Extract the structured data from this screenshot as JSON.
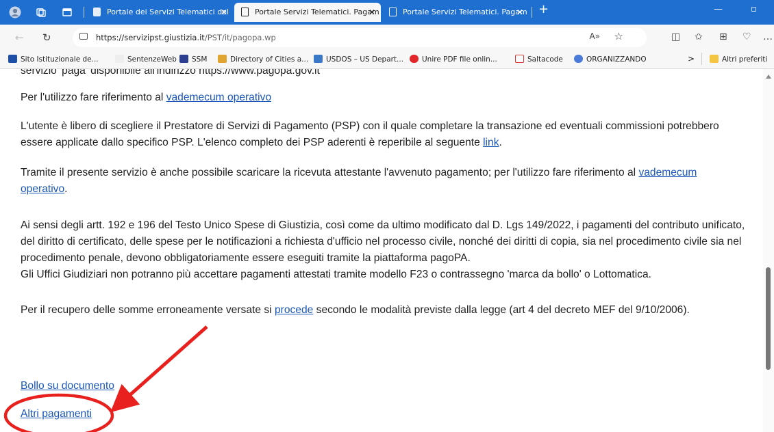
{
  "browser": {
    "tabs": [
      {
        "label": "Portale dei Servizi Telematici del"
      },
      {
        "label": "Portale Servizi Telematici. Pagam"
      },
      {
        "label": "Portale Servizi Telematici. Pagam"
      }
    ],
    "new_tab": "+",
    "address": {
      "host": "https://servizipst.giustizia.it",
      "path": "/PST/it/pagopa.wp"
    },
    "bookmarks": [
      {
        "label": "Sito Istituzionale de..."
      },
      {
        "label": "SentenzeWeb"
      },
      {
        "label": "SSM"
      },
      {
        "label": "Directory of Cities a..."
      },
      {
        "label": "USDOS – US Depart..."
      },
      {
        "label": "Unire PDF file onlin..."
      },
      {
        "label": "Saltacode"
      },
      {
        "label": "ORGANIZZANDO"
      }
    ],
    "bookmarks_more": ">",
    "other_favorites": "Altri preferiti"
  },
  "content": {
    "cut_line": "servizio 'paga' disponibile all'indirizzo https://www.pagopa.gov.it",
    "p1": {
      "text": "Per l'utilizzo fare riferimento al ",
      "link": "vademecum operativo"
    },
    "p2": {
      "text1": "L'utente è libero di scegliere il Prestatore di Servizi di Pagamento (PSP) con il quale completare la transazione ed eventuali commissioni potrebbero essere applicate dallo specifico PSP. L'elenco completo dei PSP aderenti è reperibile al seguente ",
      "link": "link",
      "text2": "."
    },
    "p3": {
      "text1": "Tramite il presente servizio è anche possibile scaricare la ricevuta attestante l'avvenuto pagamento; per l'utilizzo fare riferimento al ",
      "link": "vademecum operativo",
      "text2": "."
    },
    "p4": "Ai sensi degli artt. 192 e 196 del Testo Unico Spese di Giustizia, così come da ultimo modificato dal D. Lgs 149/2022, i pagamenti del contributo unificato, del diritto di certificato, delle spese per le notificazioni a richiesta d'ufficio nel processo civile, nonché dei diritti di copia, sia nel procedimento civile sia nel procedimento penale, devono obbligatoriamente essere eseguiti tramite la piattaforma pagoPA.",
    "p5": "Gli Uffici Giudiziari non potranno più accettare pagamenti attestati tramite modello F23 o contrassegno 'marca da bollo' o Lottomatica.",
    "p6": {
      "text1": "Per il recupero delle somme erroneamente versate si ",
      "link": "procede",
      "text2": " secondo le modalità previste dalla legge (art 4 del decreto MEF del 9/10/2006)."
    },
    "link_bollo": "Bollo su documento",
    "link_altri": "Altri pagamenti"
  },
  "colors": {
    "tabbar": "#1f6fd1",
    "link": "#1a56b8",
    "annotation": "#e8211f"
  }
}
